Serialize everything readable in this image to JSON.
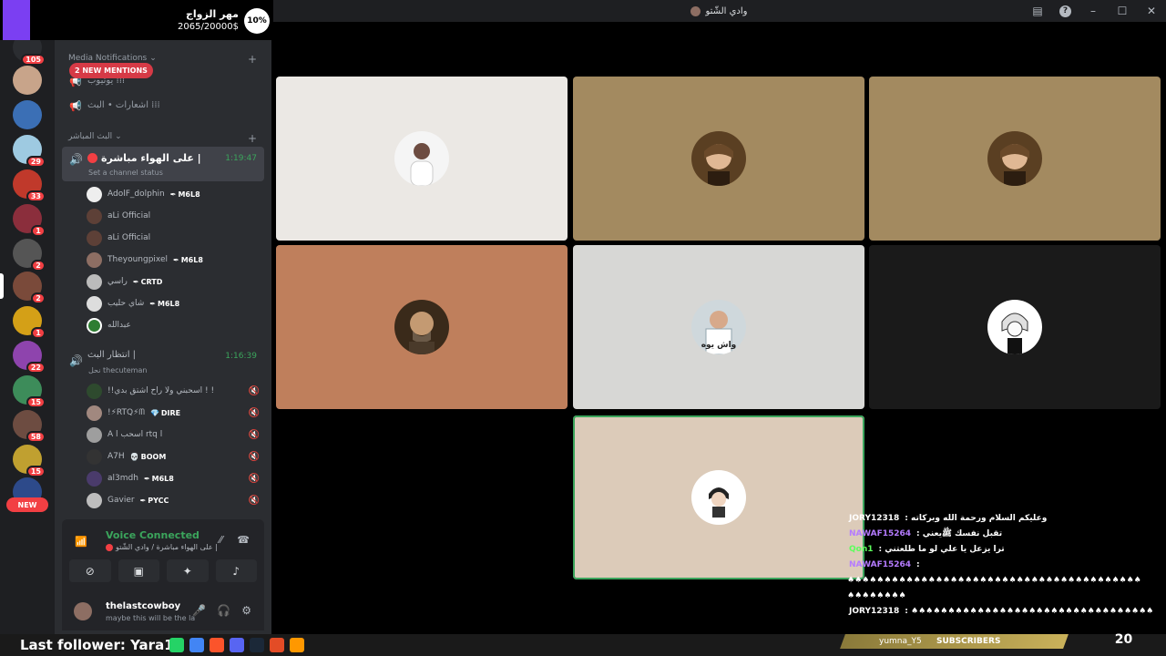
{
  "window": {
    "title": "وادي الشّتو"
  },
  "goal": {
    "title": "مهر الزواج",
    "progress": "2065/20000$",
    "percent": "10%"
  },
  "rail": {
    "badges": [
      "105",
      "29",
      "33",
      "1",
      "2",
      "2",
      "1",
      "22",
      "15",
      "58",
      "15"
    ],
    "new_label": "NEW"
  },
  "sidebar": {
    "media_category": "Media Notifications",
    "mentions": "2 NEW MENTIONS",
    "channels": [
      {
        "name": "يوتيوب ⁞⁞⁞"
      },
      {
        "name": "اشعارات • البث ⁞⁞⁞"
      }
    ],
    "live_category": "البث المباشر",
    "live_channel": {
      "name": "على الهواء مباشرة |",
      "status": "Set a channel status",
      "time": "1:19:47"
    },
    "live_users": [
      {
        "name": "AdolF_dolphin",
        "tag": "M6L8"
      },
      {
        "name": "aLi Official",
        "tag": ""
      },
      {
        "name": "aLi Official",
        "tag": ""
      },
      {
        "name": "Theyoungpixel",
        "tag": "M6L8"
      },
      {
        "name": "راسي",
        "tag": "CRTD"
      },
      {
        "name": "شاي حليب",
        "tag": "M6L8"
      },
      {
        "name": "عبدالله",
        "tag": ""
      }
    ],
    "wait_channel": {
      "name": "انتظار البث |",
      "status": "نحل thecuteman",
      "time": "1:16:39"
    },
    "wait_users": [
      {
        "name": "!!اسحبني ولا راح اشتق بدي ! !",
        "tag": ""
      },
      {
        "name": "!⚡RTQ⚡ᗰ",
        "tag": "DIRE"
      },
      {
        "name": "A l اسحب rtq l",
        "tag": ""
      },
      {
        "name": "A7H",
        "tag": "BOOM"
      },
      {
        "name": "al3mdh",
        "tag": "M6L8"
      },
      {
        "name": "Gavier",
        "tag": "PYCC"
      }
    ]
  },
  "voice": {
    "title": "Voice Connected",
    "subtitle": "على الهواء مباشرة / وادي الشّتو |"
  },
  "user": {
    "name": "thelastcowboy",
    "status": "maybe this will be the la"
  },
  "tiles": [
    {
      "bg": "#ebe8e4",
      "avatar": "person-avatar"
    },
    {
      "bg": "#a38a60",
      "avatar": "portrait-avatar"
    },
    {
      "bg": "#a38a60",
      "avatar": "portrait-avatar"
    },
    {
      "bg": "#bf7f5c",
      "avatar": "portrait-avatar"
    },
    {
      "bg": "#d7d7d5",
      "avatar": "doctor-avatar",
      "caption": "واش يوه"
    },
    {
      "bg": "#1a1a1a",
      "avatar": "anime-avatar"
    },
    {
      "bg": "#dccbb9",
      "avatar": "anime-avatar"
    }
  ],
  "chat": [
    {
      "user": "JORY12318",
      "color": "#ffffff",
      "text": ": وعليكم السلام ورحمة الله وبركاته"
    },
    {
      "user": "NAWAF15264",
      "color": "#b57bff",
      "text": ": تقبل نفسك ﷺيعني"
    },
    {
      "user": "Qon1",
      "color": "#5cff5c",
      "text": ": ترا يزعل يا علي لو ما طلعتني"
    },
    {
      "user": "NAWAF15264",
      "color": "#b57bff",
      "text": ":"
    },
    {
      "user": "",
      "color": "#ffffff",
      "text": "♠♠♠♠♠♠♠♠♠♠♠♠♠♠♠♠♠♠♠♠♠♠♠♠♠♠♠♠♠♠♠♠♠♠♠♠♠♠♠♠"
    },
    {
      "user": "",
      "color": "#ffffff",
      "text": "♠♠♠♠♠♠♠♠"
    },
    {
      "user": "JORY12318",
      "color": "#ffffff",
      "text": ": ♠♠♠♠♠♠♠♠♠♠♠♠♠♠♠♠♠♠♠♠♠♠♠♠♠♠♠♠♠♠♠♠♠"
    }
  ],
  "subscribers": {
    "name": "yumna_Y5",
    "label": "SUBSCRIBERS",
    "count": "20"
  },
  "taskbar": {
    "follower": "Last follower: Yara1e"
  }
}
